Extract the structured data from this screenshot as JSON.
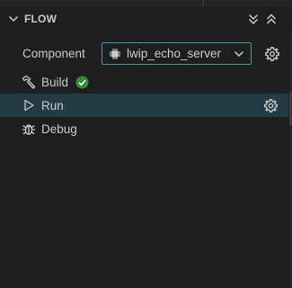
{
  "section": {
    "title": "FLOW",
    "expanded": true
  },
  "component": {
    "label": "Component",
    "selected_value": "lwip_echo_server"
  },
  "flow_items": [
    {
      "label": "Build",
      "icon": "hammer-icon",
      "status": "success"
    },
    {
      "label": "Run",
      "icon": "play-icon",
      "selected": true
    },
    {
      "label": "Debug",
      "icon": "bug-icon"
    }
  ],
  "colors": {
    "background": "#1e1e1e",
    "selected_row": "#233b44",
    "dropdown_border": "#3aa0a8",
    "success": "#388a34",
    "text": "#cccccc"
  }
}
